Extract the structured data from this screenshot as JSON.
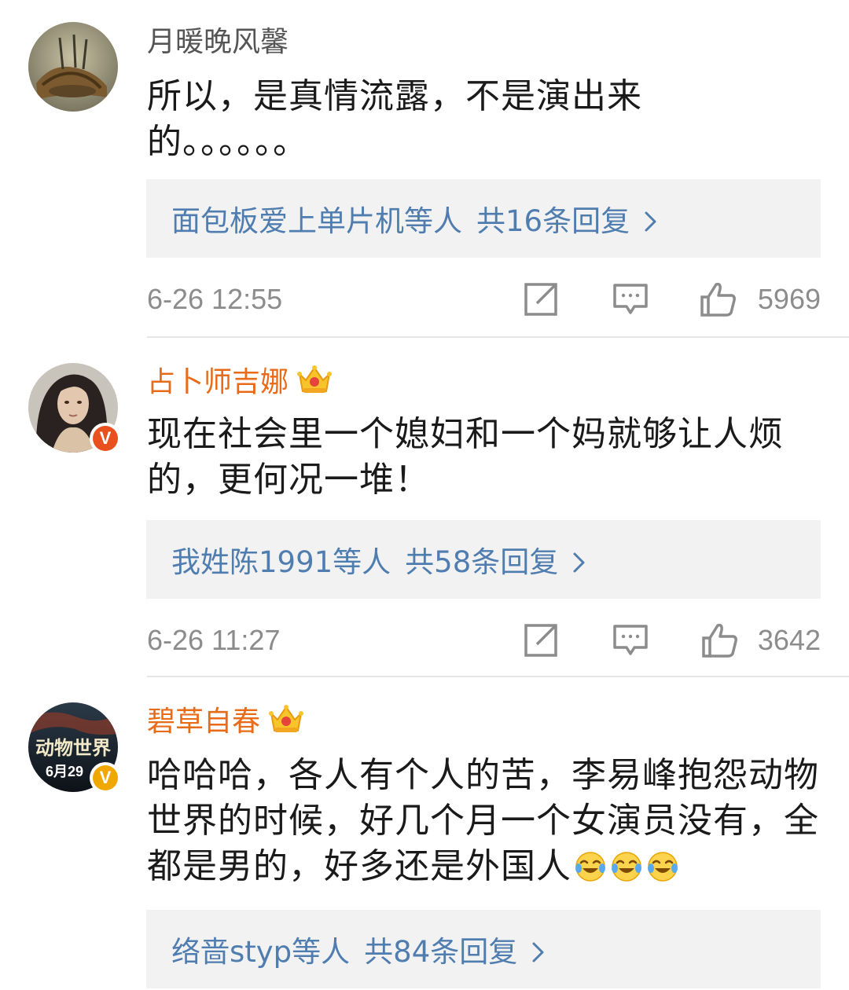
{
  "comments": [
    {
      "username": "月暖晚风馨",
      "username_color": "#555555",
      "text_line1": "所以，是真情流露，不是演出来",
      "text_line2": "的。。。。。。",
      "reply_users": "面包板爱上单片机等人",
      "reply_count": "共16条回复",
      "time": "6-26 12:55",
      "likes": "5969",
      "verified": false,
      "crown": false
    },
    {
      "username": "占卜师吉娜",
      "username_color": "#e86b1a",
      "text_line1": "现在社会里一个媳妇和一个妈就够让人烦",
      "text_line2": "的，更何况一堆！",
      "reply_users": "我姓陈1991等人",
      "reply_count": "共58条回复",
      "time": "6-26 11:27",
      "likes": "3642",
      "verified": true,
      "badge_color": "#e8501e",
      "badge_letter": "V",
      "crown": true
    },
    {
      "username": "碧草自春",
      "username_color": "#e86b1a",
      "text_line1": "哈哈哈，各人有个人的苦，李易峰抱怨动物",
      "text_line2": "世界的时候，好几个月一个女演员没有，全",
      "text_line3": "都是男的，好多还是外国人",
      "reply_users": "络啬styp等人",
      "reply_count": "共84条回复",
      "verified": true,
      "badge_color": "#f0a800",
      "badge_letter": "V",
      "crown": true,
      "avatar_text": "动物世界",
      "avatar_date": "6月29"
    }
  ],
  "icons": {
    "repost": "repost-icon",
    "comment": "comment-icon",
    "like": "thumbs-up-icon",
    "reply_chevron": "chevron-right-icon",
    "crown": "crown-icon",
    "emoji": "laugh-cry-emoji-icon"
  }
}
